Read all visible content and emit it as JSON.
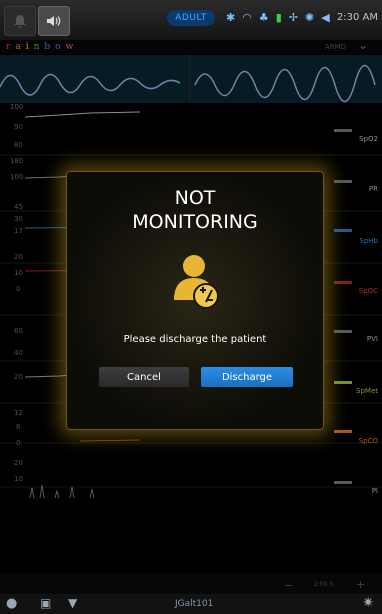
{
  "statusbar": {
    "patient_mode": "ADULT",
    "time": "2:30 AM",
    "icons": [
      "bell-icon",
      "speaker-icon",
      "bluetooth-icon",
      "wifi-icon",
      "network-icon",
      "battery-icon",
      "wireless-icon",
      "sensor-icon",
      "volume-icon"
    ]
  },
  "header": {
    "brand": "rainbow",
    "brand_colors": [
      "#ff4040",
      "#ff9a2e",
      "#ffe14a",
      "#6cd36c",
      "#4fa3ff",
      "#9b6cff",
      "#ff6cd6"
    ],
    "armed_label": "ARMD"
  },
  "axis": {
    "ticks": [
      "100",
      "90",
      "80",
      "180",
      "100",
      "45",
      "30",
      "17",
      "20",
      "10",
      "0",
      "60",
      "40",
      "20",
      "12",
      "8",
      "0",
      "20",
      "10"
    ]
  },
  "side_labels": [
    {
      "text": "SpO2",
      "color": "#d8d8d8"
    },
    {
      "text": "PR",
      "color": "#d8d8d8"
    },
    {
      "text": "SpHb",
      "color": "#3bb0ff"
    },
    {
      "text": "SpOC",
      "color": "#ff4b4b"
    },
    {
      "text": "PVI",
      "color": "#d8d8d8"
    },
    {
      "text": "SpMet",
      "color": "#b7e04a"
    },
    {
      "text": "SpCO",
      "color": "#ff8a2e"
    },
    {
      "text": "PI",
      "color": "#d8d8d8"
    }
  ],
  "bottom": {
    "zoom": "2:00 h",
    "minus": "−",
    "plus": "+",
    "device_name": "JGalt101"
  },
  "dialog": {
    "title_line1": "NOT",
    "title_line2": "MONITORING",
    "message": "Please discharge the patient",
    "cancel_label": "Cancel",
    "discharge_label": "Discharge",
    "accent": "#d9a520",
    "primary": "#1f7fd8"
  }
}
